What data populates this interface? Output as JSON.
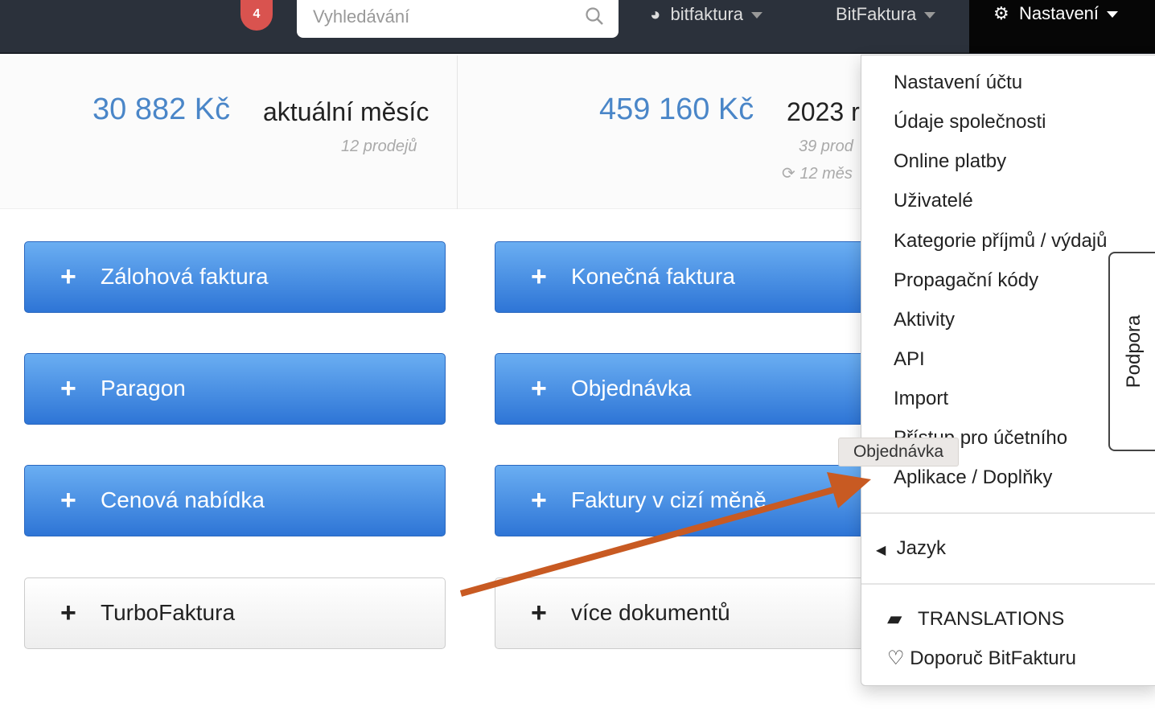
{
  "nav": {
    "notification_count": "4",
    "search_placeholder": "Vyhledávání",
    "account": "bitfaktura",
    "company": "BitFaktura",
    "settings": "Nastavení"
  },
  "stats": [
    {
      "amount": "30 882 Kč",
      "label": "aktuální měsíc",
      "sales": "12 prodejů"
    },
    {
      "amount": "459 160 Kč",
      "label": "2023 r",
      "sales": "39 prod",
      "period": "12 měs"
    }
  ],
  "buttons": [
    "Zálohová faktura",
    "Konečná faktura",
    "Paragon",
    "Objednávka",
    "Cenová nabídka",
    "Faktury v cizí měně",
    "TurboFaktura",
    "více dokumentů"
  ],
  "menu": {
    "items": [
      "Nastavení účtu",
      "Údaje společnosti",
      "Online platby",
      "Uživatelé",
      "Kategorie příjmů / výdajů",
      "Propagační kódy",
      "Aktivity",
      "API",
      "Import",
      "Přístup pro účetního",
      "Aplikace / Doplňky"
    ],
    "language": "Jazyk",
    "translations": "TRANSLATIONS",
    "recommend": "Doporuč BitFakturu"
  },
  "support_tab": "Podpora",
  "tooltip": "Objednávka",
  "colors": {
    "navbar": "#2b313b",
    "primary_button": "#3a82dc",
    "amount": "#4a86c8",
    "annotation_arrow": "#c85a22"
  }
}
